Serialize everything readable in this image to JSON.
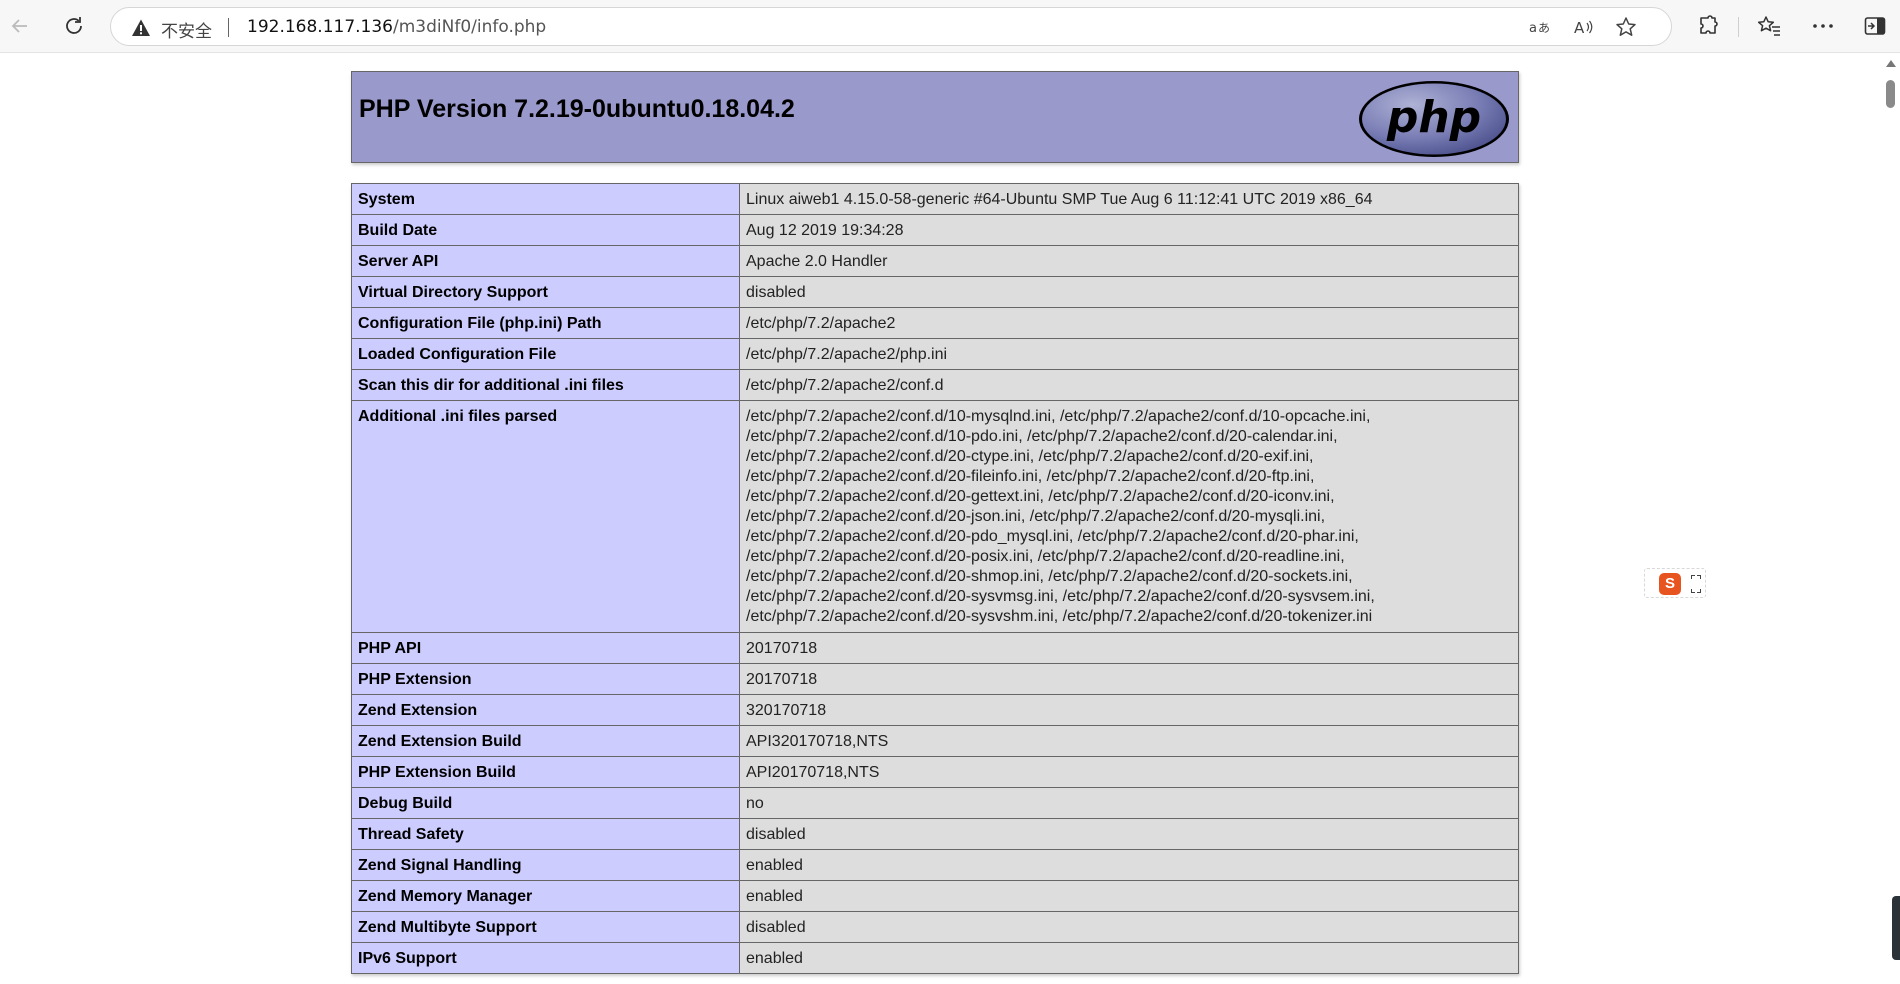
{
  "browser": {
    "security_label": "不安全",
    "url_host": "192.168.117.136",
    "url_path": "/m3diNf0/info.php",
    "icons": [
      "back-icon",
      "refresh-icon",
      "warning-icon",
      "read-translate-icon",
      "read-aloud-icon",
      "favorite-star-icon",
      "extensions-icon",
      "favorites-icon",
      "more-icon",
      "sidebar-icon"
    ]
  },
  "phpinfo": {
    "title": "PHP Version 7.2.19-0ubuntu0.18.04.2",
    "logo_text": "php",
    "colors": {
      "header_bg": "#9999cc",
      "key_bg": "#ccccff",
      "value_bg": "#dddddd",
      "border": "#666666"
    },
    "rows": [
      {
        "key": "System",
        "value": "Linux aiweb1 4.15.0-58-generic #64-Ubuntu SMP Tue Aug 6 11:12:41 UTC 2019 x86_64"
      },
      {
        "key": "Build Date",
        "value": "Aug 12 2019 19:34:28"
      },
      {
        "key": "Server API",
        "value": "Apache 2.0 Handler"
      },
      {
        "key": "Virtual Directory Support",
        "value": "disabled"
      },
      {
        "key": "Configuration File (php.ini) Path",
        "value": "/etc/php/7.2/apache2"
      },
      {
        "key": "Loaded Configuration File",
        "value": "/etc/php/7.2/apache2/php.ini"
      },
      {
        "key": "Scan this dir for additional .ini files",
        "value": "/etc/php/7.2/apache2/conf.d"
      },
      {
        "key": "Additional .ini files parsed",
        "lines": [
          "/etc/php/7.2/apache2/conf.d/10-mysqlnd.ini, /etc/php/7.2/apache2/conf.d/10-opcache.ini,",
          "/etc/php/7.2/apache2/conf.d/10-pdo.ini, /etc/php/7.2/apache2/conf.d/20-calendar.ini,",
          "/etc/php/7.2/apache2/conf.d/20-ctype.ini, /etc/php/7.2/apache2/conf.d/20-exif.ini,",
          "/etc/php/7.2/apache2/conf.d/20-fileinfo.ini, /etc/php/7.2/apache2/conf.d/20-ftp.ini,",
          "/etc/php/7.2/apache2/conf.d/20-gettext.ini, /etc/php/7.2/apache2/conf.d/20-iconv.ini,",
          "/etc/php/7.2/apache2/conf.d/20-json.ini, /etc/php/7.2/apache2/conf.d/20-mysqli.ini,",
          "/etc/php/7.2/apache2/conf.d/20-pdo_mysql.ini, /etc/php/7.2/apache2/conf.d/20-phar.ini,",
          "/etc/php/7.2/apache2/conf.d/20-posix.ini, /etc/php/7.2/apache2/conf.d/20-readline.ini,",
          "/etc/php/7.2/apache2/conf.d/20-shmop.ini, /etc/php/7.2/apache2/conf.d/20-sockets.ini,",
          "/etc/php/7.2/apache2/conf.d/20-sysvmsg.ini, /etc/php/7.2/apache2/conf.d/20-sysvsem.ini,",
          "/etc/php/7.2/apache2/conf.d/20-sysvshm.ini, /etc/php/7.2/apache2/conf.d/20-tokenizer.ini"
        ]
      },
      {
        "key": "PHP API",
        "value": "20170718"
      },
      {
        "key": "PHP Extension",
        "value": "20170718"
      },
      {
        "key": "Zend Extension",
        "value": "320170718"
      },
      {
        "key": "Zend Extension Build",
        "value": "API320170718,NTS"
      },
      {
        "key": "PHP Extension Build",
        "value": "API20170718,NTS"
      },
      {
        "key": "Debug Build",
        "value": "no"
      },
      {
        "key": "Thread Safety",
        "value": "disabled"
      },
      {
        "key": "Zend Signal Handling",
        "value": "enabled"
      },
      {
        "key": "Zend Memory Manager",
        "value": "enabled"
      },
      {
        "key": "Zend Multibyte Support",
        "value": "disabled"
      },
      {
        "key": "IPv6 Support",
        "value": "enabled"
      }
    ]
  },
  "ime_widget": {
    "label": "S"
  }
}
